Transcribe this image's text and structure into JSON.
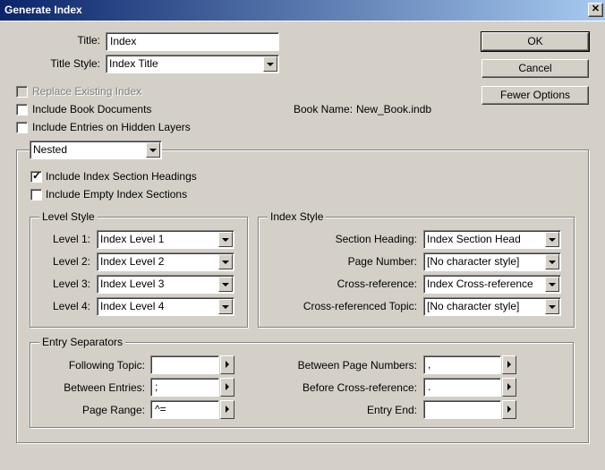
{
  "window": {
    "title": "Generate Index"
  },
  "top": {
    "title_label": "Title:",
    "title_value": "Index",
    "title_style_label": "Title Style:",
    "title_style_value": "Index Title"
  },
  "buttons": {
    "ok": "OK",
    "cancel": "Cancel",
    "fewer_options": "Fewer Options"
  },
  "options": {
    "replace_existing": {
      "label": "Replace Existing Index",
      "checked": false,
      "enabled": false
    },
    "include_book": {
      "label": "Include Book Documents",
      "checked": false
    },
    "include_hidden": {
      "label": "Include Entries on Hidden Layers",
      "checked": false
    },
    "book_name_label": "Book Name:",
    "book_name_value": "New_Book.indb"
  },
  "format": {
    "value": "Nested"
  },
  "section_options": {
    "include_headings": {
      "label": "Include Index Section Headings",
      "checked": true
    },
    "include_empty": {
      "label": "Include Empty Index Sections",
      "checked": false
    }
  },
  "level_style": {
    "title": "Level Style",
    "levels": [
      {
        "label": "Level 1:",
        "value": "Index Level 1"
      },
      {
        "label": "Level 2:",
        "value": "Index Level 2"
      },
      {
        "label": "Level 3:",
        "value": "Index Level 3"
      },
      {
        "label": "Level 4:",
        "value": "Index Level 4"
      }
    ]
  },
  "index_style": {
    "title": "Index Style",
    "rows": [
      {
        "label": "Section Heading:",
        "value": "Index Section Head"
      },
      {
        "label": "Page Number:",
        "value": "[No character style]"
      },
      {
        "label": "Cross-reference:",
        "value": "Index Cross-reference"
      },
      {
        "label": "Cross-referenced Topic:",
        "value": "[No character style]"
      }
    ]
  },
  "entry_separators": {
    "title": "Entry Separators",
    "left": [
      {
        "label": "Following Topic:",
        "value": ""
      },
      {
        "label": "Between Entries:",
        "value": ";"
      },
      {
        "label": "Page Range:",
        "value": "^="
      }
    ],
    "right": [
      {
        "label": "Between Page Numbers:",
        "value": ","
      },
      {
        "label": "Before Cross-reference:",
        "value": "."
      },
      {
        "label": "Entry End:",
        "value": ""
      }
    ]
  }
}
